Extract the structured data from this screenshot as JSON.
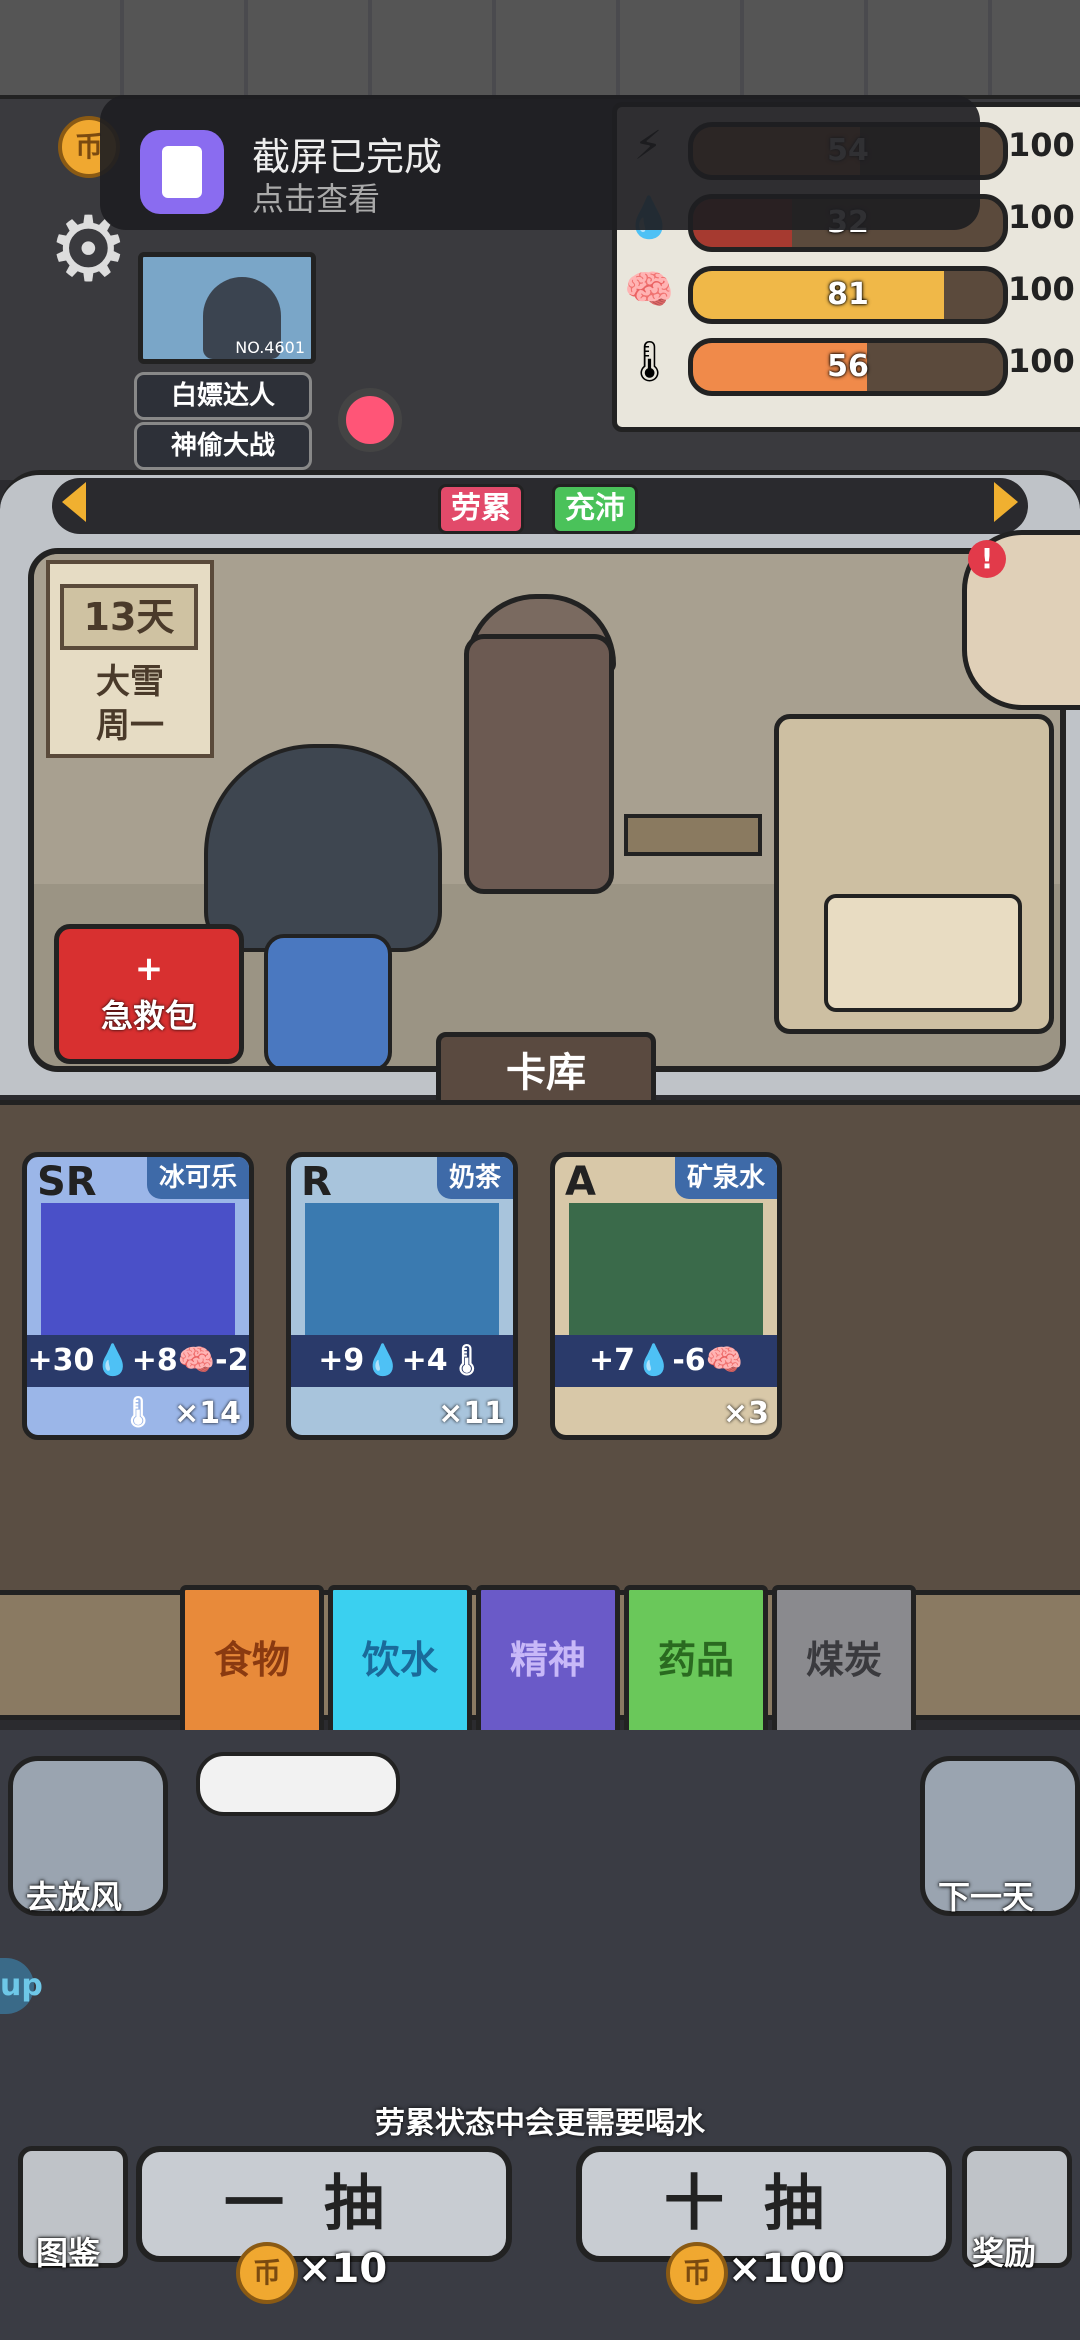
{
  "notification": {
    "title": "截屏已完成",
    "subtitle": "点击查看"
  },
  "header": {
    "coin_glyph": "币",
    "avatar_no": "NO.4601",
    "badges": [
      "白嫖达人",
      "神偷大战"
    ]
  },
  "stats": [
    {
      "name": "energy-stat",
      "icon": "lightning-icon",
      "glyph": "⚡",
      "value": 54,
      "max": "100",
      "fill_color": "#c67a4a",
      "fill": 0.54
    },
    {
      "name": "water-stat",
      "icon": "water-drop-icon",
      "glyph": "💧",
      "value": 32,
      "max": "100",
      "fill_color": "#a63a30",
      "fill": 0.32
    },
    {
      "name": "mind-stat",
      "icon": "brain-icon",
      "glyph": "🧠",
      "value": 81,
      "max": "100",
      "fill_color": "#f0b848",
      "fill": 0.81
    },
    {
      "name": "temperature-stat",
      "icon": "thermometer-icon",
      "glyph": "🌡",
      "value": 56,
      "max": "100",
      "fill_color": "#f08a4a",
      "fill": 0.56
    }
  ],
  "status_tags": [
    {
      "label": "劳累",
      "color": "#e24a6a"
    },
    {
      "label": "充沛",
      "color": "#4ac25a"
    }
  ],
  "calendar": {
    "day": "13天",
    "weather": "大雪",
    "weekday": "周一"
  },
  "medkit_label": "急救包",
  "card_library_tab": "卡库",
  "cards": [
    {
      "rank": "SR",
      "name": "冰可乐",
      "effects": "+30💧+8🧠-2🌡",
      "count": "×14",
      "bg": "#9bb6e8",
      "art": "#4a50c8"
    },
    {
      "rank": "R",
      "name": "奶茶",
      "effects": "+9💧+4🌡",
      "count": "×11",
      "bg": "#a8c4dc",
      "art": "#3a7ab0"
    },
    {
      "rank": "A",
      "name": "矿泉水",
      "effects": "+7💧-6🧠",
      "count": "×3",
      "bg": "#d8c8a8",
      "art": "#3a6a4a"
    }
  ],
  "categories": [
    {
      "label": "食物",
      "bg": "#e88a3a",
      "fg": "#8a3a10"
    },
    {
      "label": "饮水",
      "bg": "#3ad0f0",
      "fg": "#1a6a9a"
    },
    {
      "label": "精神",
      "bg": "#6a5ac8",
      "fg": "#c8b8f8"
    },
    {
      "label": "药品",
      "bg": "#6ac85a",
      "fg": "#2a6a20"
    },
    {
      "label": "煤炭",
      "bg": "#8a8a8e",
      "fg": "#3a3a3e"
    }
  ],
  "side_buttons": {
    "left": "去放风",
    "right": "下一天"
  },
  "hint": "劳累状态中会更需要喝水",
  "draw": [
    {
      "label": "一抽",
      "cost": "×10"
    },
    {
      "label": "十抽",
      "cost": "×100"
    }
  ],
  "bottom_buttons": {
    "guide": "图鉴",
    "reward": "奖励"
  },
  "up_tag": "up"
}
